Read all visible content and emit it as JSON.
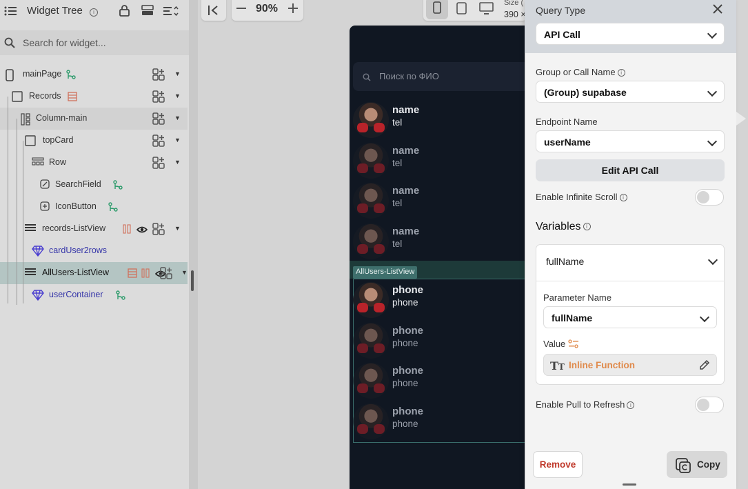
{
  "widget_tree": {
    "title": "Widget Tree",
    "search_placeholder": "Search for widget...",
    "nodes": [
      {
        "label": "mainPage",
        "icon": "phone-icon",
        "color": "default"
      },
      {
        "label": "Records",
        "icon": "container-icon",
        "color": "default"
      },
      {
        "label": "Column-main",
        "icon": "column-icon",
        "color": "default"
      },
      {
        "label": "topCard",
        "icon": "container-icon",
        "color": "default"
      },
      {
        "label": "Row",
        "icon": "row-icon",
        "color": "default"
      },
      {
        "label": "SearchField",
        "icon": "textfield-icon",
        "color": "default"
      },
      {
        "label": "IconButton",
        "icon": "iconbutton-icon",
        "color": "default"
      },
      {
        "label": "records-ListView",
        "icon": "listview-icon",
        "color": "default"
      },
      {
        "label": "cardUser2rows",
        "icon": "component-icon",
        "color": "blue"
      },
      {
        "label": "AllUsers-ListView",
        "icon": "listview-icon",
        "color": "selected"
      },
      {
        "label": "userContainer",
        "icon": "component-icon",
        "color": "blue"
      }
    ]
  },
  "toolbar": {
    "zoom": "90%",
    "size_label": "Size (",
    "size_value": "390 ×"
  },
  "canvas": {
    "search_placeholder": "Поиск по ФИО",
    "records_items": [
      {
        "name": "name",
        "tel": "tel"
      },
      {
        "name": "name",
        "tel": "tel"
      },
      {
        "name": "name",
        "tel": "tel"
      },
      {
        "name": "name",
        "tel": "tel"
      }
    ],
    "allusers_tag": "AllUsers-ListView",
    "allusers_items": [
      {
        "name": "phone",
        "tel": "phone"
      },
      {
        "name": "phone",
        "tel": "phone"
      },
      {
        "name": "phone",
        "tel": "phone"
      },
      {
        "name": "phone",
        "tel": "phone"
      }
    ]
  },
  "query_panel": {
    "query_type_label": "Query Type",
    "query_type_value": "API Call",
    "group_label": "Group or Call Name",
    "group_value": "(Group) supabase",
    "endpoint_label": "Endpoint Name",
    "endpoint_value": "userName",
    "edit_button": "Edit API Call",
    "infinite_scroll_label": "Enable Infinite Scroll",
    "variables_title": "Variables",
    "variable_name": "fullName",
    "parameter_label": "Parameter Name",
    "parameter_value": "fullName",
    "value_label": "Value",
    "inline_function": "Inline Function",
    "pull_refresh_label": "Enable Pull to Refresh",
    "remove_button": "Remove",
    "copy_button": "Copy",
    "accent_orange": "#e08a4b",
    "remove_red": "#c0392b"
  }
}
